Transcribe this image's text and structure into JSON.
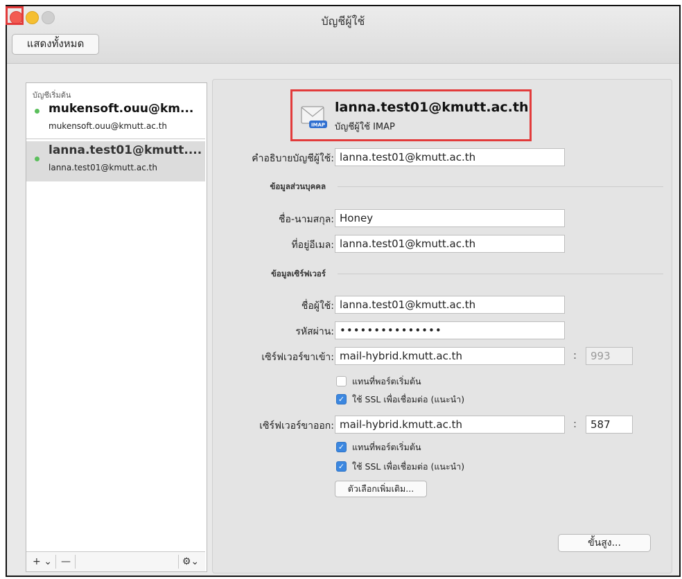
{
  "window": {
    "title": "บัญชีผู้ใช้",
    "show_all_label": "แสดงทั้งหมด"
  },
  "sidebar": {
    "heading": "บัญชีเริ่มต้น",
    "accounts": [
      {
        "name": "mukensoft.ouu@km...",
        "email": "mukensoft.ouu@kmutt.ac.th",
        "status_color": "#5bbf5c"
      },
      {
        "name": "lanna.test01@kmutt....",
        "email": "lanna.test01@kmutt.ac.th",
        "status_color": "#5bbf5c"
      }
    ],
    "footer": {
      "add_label": "+ ⌄",
      "remove_label": "—",
      "gear_label": "⚙⌄"
    }
  },
  "detail": {
    "header": {
      "email": "lanna.test01@kmutt.ac.th",
      "type": "บัญชีผู้ใช้ IMAP",
      "icon_badge": "IMAP"
    },
    "description": {
      "label": "คำอธิบายบัญชีผู้ใช้:",
      "value": "lanna.test01@kmutt.ac.th"
    },
    "personal_section": "ข้อมูลส่วนบุคคล",
    "full_name": {
      "label": "ชื่อ-นามสกุล:",
      "value": "Honey"
    },
    "email_address": {
      "label": "ที่อยู่อีเมล:",
      "value": "lanna.test01@kmutt.ac.th"
    },
    "server_section": "ข้อมูลเซิร์ฟเวอร์",
    "username": {
      "label": "ชื่อผู้ใช้:",
      "value": "lanna.test01@kmutt.ac.th"
    },
    "password": {
      "label": "รหัสผ่าน:",
      "value": "•••••••••••••••"
    },
    "incoming": {
      "label": "เซิร์ฟเวอร์ขาเข้า:",
      "value": "mail-hybrid.kmutt.ac.th",
      "port": "993",
      "override_port_label": "แทนที่พอร์ตเริ่มต้น",
      "override_port_checked": false,
      "ssl_label": "ใช้ SSL เพื่อเชื่อมต่อ (แนะนำ)",
      "ssl_checked": true
    },
    "outgoing": {
      "label": "เซิร์ฟเวอร์ขาออก:",
      "value": "mail-hybrid.kmutt.ac.th",
      "port": "587",
      "override_port_label": "แทนที่พอร์ตเริ่มต้น",
      "override_port_checked": true,
      "ssl_label": "ใช้ SSL เพื่อเชื่อมต่อ (แนะนำ)",
      "ssl_checked": true
    },
    "more_options_label": "ตัวเลือกเพิ่มเติม...",
    "advanced_label": "ขั้นสูง...",
    "colors": {
      "checkbox_on": "#3b87e0",
      "highlight": "#e23b3b"
    }
  }
}
